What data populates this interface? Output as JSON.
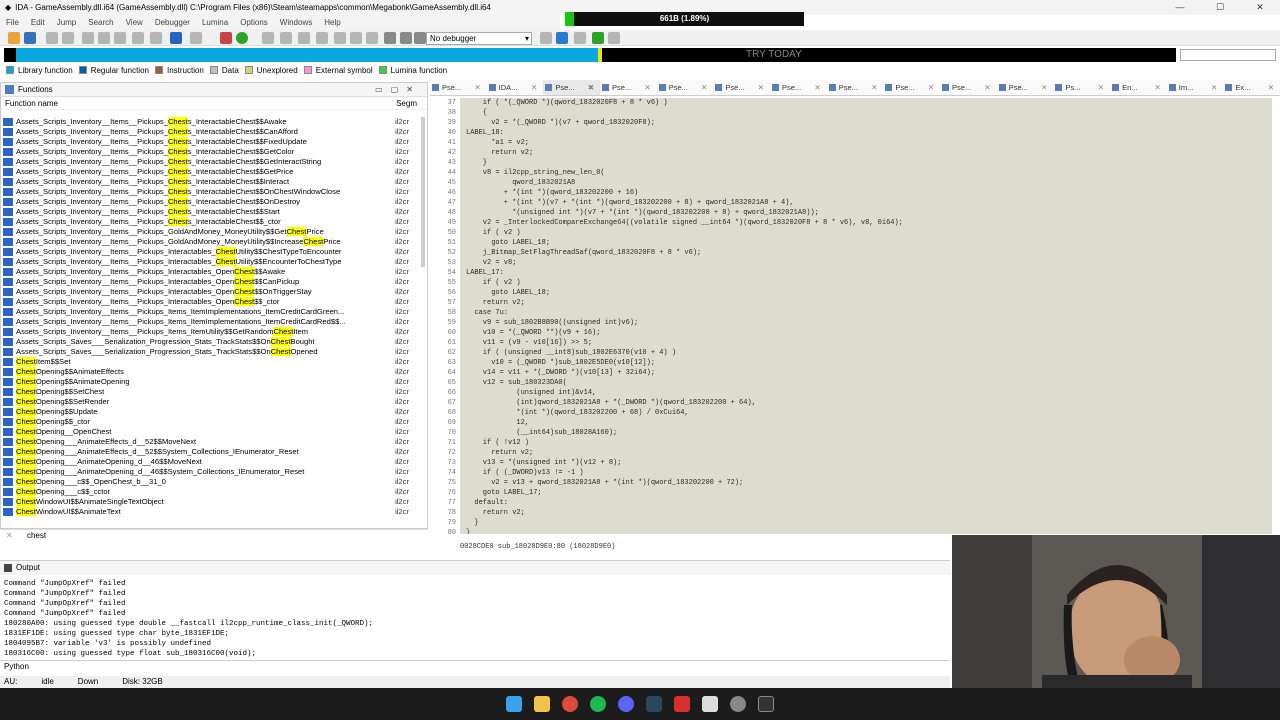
{
  "window": {
    "title": "IDA - GameAssembly.dll.i64 (GameAssembly.dll) C:\\Program Files (x86)\\Steam\\steamapps\\common\\Megabonk\\GameAssembly.dll.i64",
    "perf": "661B (1.89%)",
    "perf_fill": 0.0189
  },
  "menu": [
    "File",
    "Edit",
    "Jump",
    "Search",
    "View",
    "Debugger",
    "Lumina",
    "Options",
    "Windows",
    "Help"
  ],
  "toolbar": {
    "debugger": "No debugger"
  },
  "nav": {
    "trial_text": "TRY TODAY"
  },
  "legend": [
    {
      "label": "Library function",
      "color": "#0aa7e0"
    },
    {
      "label": "Regular function",
      "color": "#0060b0"
    },
    {
      "label": "Instruction",
      "color": "#a05a3e"
    },
    {
      "label": "Data",
      "color": "#c0c0c0"
    },
    {
      "label": "Unexplored",
      "color": "#d2d27a"
    },
    {
      "label": "External symbol",
      "color": "#ff8cd8"
    },
    {
      "label": "Lumina function",
      "color": "#40cc40"
    }
  ],
  "functions": {
    "title": "Functions",
    "col_name": "Function name",
    "col_seg": "Segm",
    "segment": "il2cr",
    "rows": [
      [
        "Assets_Scripts_Inventory__Items__Pickups_",
        "Chest",
        "s_InteractableChest$$Awake"
      ],
      [
        "Assets_Scripts_Inventory__Items__Pickups_",
        "Chest",
        "s_InteractableChest$$CanAfford"
      ],
      [
        "Assets_Scripts_Inventory__Items__Pickups_",
        "Chest",
        "s_InteractableChest$$FixedUpdate"
      ],
      [
        "Assets_Scripts_Inventory__Items__Pickups_",
        "Chest",
        "s_InteractableChest$$GetColor"
      ],
      [
        "Assets_Scripts_Inventory__Items__Pickups_",
        "Chest",
        "s_InteractableChest$$GetInteractString"
      ],
      [
        "Assets_Scripts_Inventory__Items__Pickups_",
        "Chest",
        "s_InteractableChest$$GetPrice"
      ],
      [
        "Assets_Scripts_Inventory__Items__Pickups_",
        "Chest",
        "s_InteractableChest$$Interact"
      ],
      [
        "Assets_Scripts_Inventory__Items__Pickups_",
        "Chest",
        "s_InteractableChest$$OnChestWindowClose"
      ],
      [
        "Assets_Scripts_Inventory__Items__Pickups_",
        "Chest",
        "s_InteractableChest$$OnDestroy"
      ],
      [
        "Assets_Scripts_Inventory__Items__Pickups_",
        "Chest",
        "s_InteractableChest$$Start"
      ],
      [
        "Assets_Scripts_Inventory__Items__Pickups_",
        "Chest",
        "s_InteractableChest$$_ctor"
      ],
      [
        "Assets_Scripts_Inventory__Items__Pickups_GoldAndMoney_MoneyUtility$$Get",
        "Chest",
        "Price"
      ],
      [
        "Assets_Scripts_Inventory__Items__Pickups_GoldAndMoney_MoneyUtility$$Increase",
        "Chest",
        "Price"
      ],
      [
        "Assets_Scripts_Inventory__Items__Pickups_Interactables_",
        "Chest",
        "Utility$$ChestTypeToEncounter"
      ],
      [
        "Assets_Scripts_Inventory__Items__Pickups_Interactables_",
        "Chest",
        "Utility$$EncounterToChestType"
      ],
      [
        "Assets_Scripts_Inventory__Items__Pickups_Interactables_Open",
        "Chest",
        "$$Awake"
      ],
      [
        "Assets_Scripts_Inventory__Items__Pickups_Interactables_Open",
        "Chest",
        "$$CanPickup"
      ],
      [
        "Assets_Scripts_Inventory__Items__Pickups_Interactables_Open",
        "Chest",
        "$$OnTriggerStay"
      ],
      [
        "Assets_Scripts_Inventory__Items__Pickups_Interactables_Open",
        "Chest",
        "$$_ctor"
      ],
      [
        "Assets_Scripts_Inventory__Items__Pickups_Items_ItemImplementations_ItemCreditCardGreen...",
        "",
        ""
      ],
      [
        "Assets_Scripts_Inventory__Items__Pickups_Items_ItemImplementations_ItemCreditCardRed$$...",
        "",
        ""
      ],
      [
        "Assets_Scripts_Inventory__Items__Pickups_Items_ItemUtility$$GetRandom",
        "Chest",
        "Item"
      ],
      [
        "Assets_Scripts_Saves___Serialization_Progression_Stats_TrackStats$$On",
        "Chest",
        "Bought"
      ],
      [
        "Assets_Scripts_Saves___Serialization_Progression_Stats_TrackStats$$On",
        "Chest",
        "Opened"
      ],
      [
        "",
        "Chest",
        "Item$$Set"
      ],
      [
        "",
        "Chest",
        "Opening$$AnimateEffects"
      ],
      [
        "",
        "Chest",
        "Opening$$AnimateOpening"
      ],
      [
        "",
        "Chest",
        "Opening$$SetChest"
      ],
      [
        "",
        "Chest",
        "Opening$$SetRender"
      ],
      [
        "",
        "Chest",
        "Opening$$Update"
      ],
      [
        "",
        "Chest",
        "Opening$$_ctor"
      ],
      [
        "",
        "Chest",
        "Opening__OpenChest"
      ],
      [
        "",
        "Chest",
        "Opening___AnimateEffects_d__52$$MoveNext"
      ],
      [
        "",
        "Chest",
        "Opening___AnimateEffects_d__52$$System_Collections_IEnumerator_Reset"
      ],
      [
        "",
        "Chest",
        "Opening___AnimateOpening_d__46$$MoveNext"
      ],
      [
        "",
        "Chest",
        "Opening___AnimateOpening_d__46$$System_Collections_IEnumerator_Reset"
      ],
      [
        "",
        "Chest",
        "Opening___c$$_OpenChest_b__31_0"
      ],
      [
        "",
        "Chest",
        "Opening___c$$_cctor"
      ],
      [
        "",
        "Chest",
        "WindowUI$$AnimateSingleTextObject"
      ],
      [
        "",
        "Chest",
        "WindowUI$$AnimateText"
      ]
    ],
    "filter": "chest"
  },
  "tabs": [
    "Pse...",
    "IDA...",
    "Pse...",
    "Pse...",
    "Pse...",
    "Pse...",
    "Pse...",
    "Pse...",
    "Pse...",
    "Pse...",
    "Pse...",
    "Ps...",
    "En...",
    "Im...",
    "Ex..."
  ],
  "code": {
    "lines": [
      [
        "37",
        "    if ( *(_QWORD *)(qword_1832020F8 + 8 * v6) )"
      ],
      [
        "38",
        "    {"
      ],
      [
        "39",
        "      v2 = *(_QWORD *)(v7 + qword_1832020F8);"
      ],
      [
        "40",
        "LABEL_18:"
      ],
      [
        "41",
        "      *a1 = v2;"
      ],
      [
        "42",
        "      return v2;"
      ],
      [
        "43",
        "    }"
      ],
      [
        "44",
        "    v8 = il2cpp_string_new_len_0("
      ],
      [
        "45",
        "           qword_1832021A8"
      ],
      [
        "46",
        "         + *(int *)(qword_183202200 + 16)"
      ],
      [
        "47",
        "         + *(int *)(v7 + *(int *)(qword_183202200 + 8) + qword_1832021A8 + 4),"
      ],
      [
        "48",
        "           *(unsigned int *)(v7 + *(int *)(qword_183202200 + 8) + qword_1832021A8));"
      ],
      [
        "49",
        "    v2 = _InterlockedCompareExchange64((volatile signed __int64 *)(qword_1832020F8 + 8 * v6), v8, 0i64);"
      ],
      [
        "50",
        "    if ( v2 )"
      ],
      [
        "51",
        "      goto LABEL_18;"
      ],
      [
        "52",
        "    j_Bitmap_SetFlagThreadSaf(qword_1832020F8 + 8 * v6);"
      ],
      [
        "53",
        "    v2 = v8;"
      ],
      [
        "54",
        "LABEL_17:"
      ],
      [
        "55",
        "    if ( v2 )"
      ],
      [
        "56",
        "      goto LABEL_18;"
      ],
      [
        "57",
        "    return v2;"
      ],
      [
        "58",
        "  case 7u:"
      ],
      [
        "59",
        "    v9 = sub_1802B8B90((unsigned int)v6);"
      ],
      [
        "60",
        "    v10 = *(_QWORD **)(v9 + 16);"
      ],
      [
        "61",
        "    v11 = (v9 - v10[16]) >> 5;"
      ],
      [
        "62",
        "    if ( (unsigned __int8)sub_1802E6370(v10 + 4) )"
      ],
      [
        "63",
        "      v10 = (_QWORD *)sub_1802E5DE0(v10[12]);"
      ],
      [
        "64",
        "    v14 = v11 + *(_DWORD *)(v10[13] + 32i64);"
      ],
      [
        "65",
        "    v12 = sub_180323DA0("
      ],
      [
        "66",
        "            (unsigned int)&v14,"
      ],
      [
        "67",
        "            (int)qword_1832021A8 + *(_DWORD *)(qword_183202200 + 64),"
      ],
      [
        "68",
        "            *(int *)(qword_183202200 + 68) / 0xCui64,"
      ],
      [
        "69",
        "            12,"
      ],
      [
        "70",
        "            (__int64)sub_18028A160);"
      ],
      [
        "71",
        "    if ( !v12 )"
      ],
      [
        "72",
        "      return v2;"
      ],
      [
        "73",
        "    v13 = *(unsigned int *)(v12 + 8);"
      ],
      [
        "74",
        "    if ( (_DWORD)v13 != -1 )"
      ],
      [
        "75",
        "      v2 = v13 + qword_1832021A8 + *(int *)(qword_183202200 + 72);"
      ],
      [
        "76",
        "    goto LABEL_17;"
      ],
      [
        "77",
        "  default:"
      ],
      [
        "78",
        "    return v2;"
      ],
      [
        "79",
        "  }"
      ],
      [
        "80",
        "}"
      ]
    ],
    "status": "0028CDE0 sub_18028D9E0:80 (18028D9E0)"
  },
  "output": {
    "title": "Output",
    "lines": [
      "Command \"JumpOpXref\" failed",
      "Command \"JumpOpXref\" failed",
      "Command \"JumpOpXref\" failed",
      "Command \"JumpOpXref\" failed",
      "180280A00: using guessed type double __fastcall il2cpp_runtime_class_init(_QWORD);",
      "1831EF1DE: using guessed type char byte_1831EF1DE;",
      "1804095B7: variable 'v3' is possibly undefined",
      "180316C00: using guessed type float sub_180316C00(void);"
    ],
    "lang": "Python"
  },
  "status": {
    "au": "AU:",
    "idle": "idle",
    "dir": "Down",
    "disk": "Disk: 32GB"
  },
  "taskbar_icons": [
    "windows-start",
    "file-explorer",
    "chrome",
    "spotify",
    "discord",
    "steam",
    "app-red",
    "app-white",
    "settings",
    "terminal"
  ]
}
